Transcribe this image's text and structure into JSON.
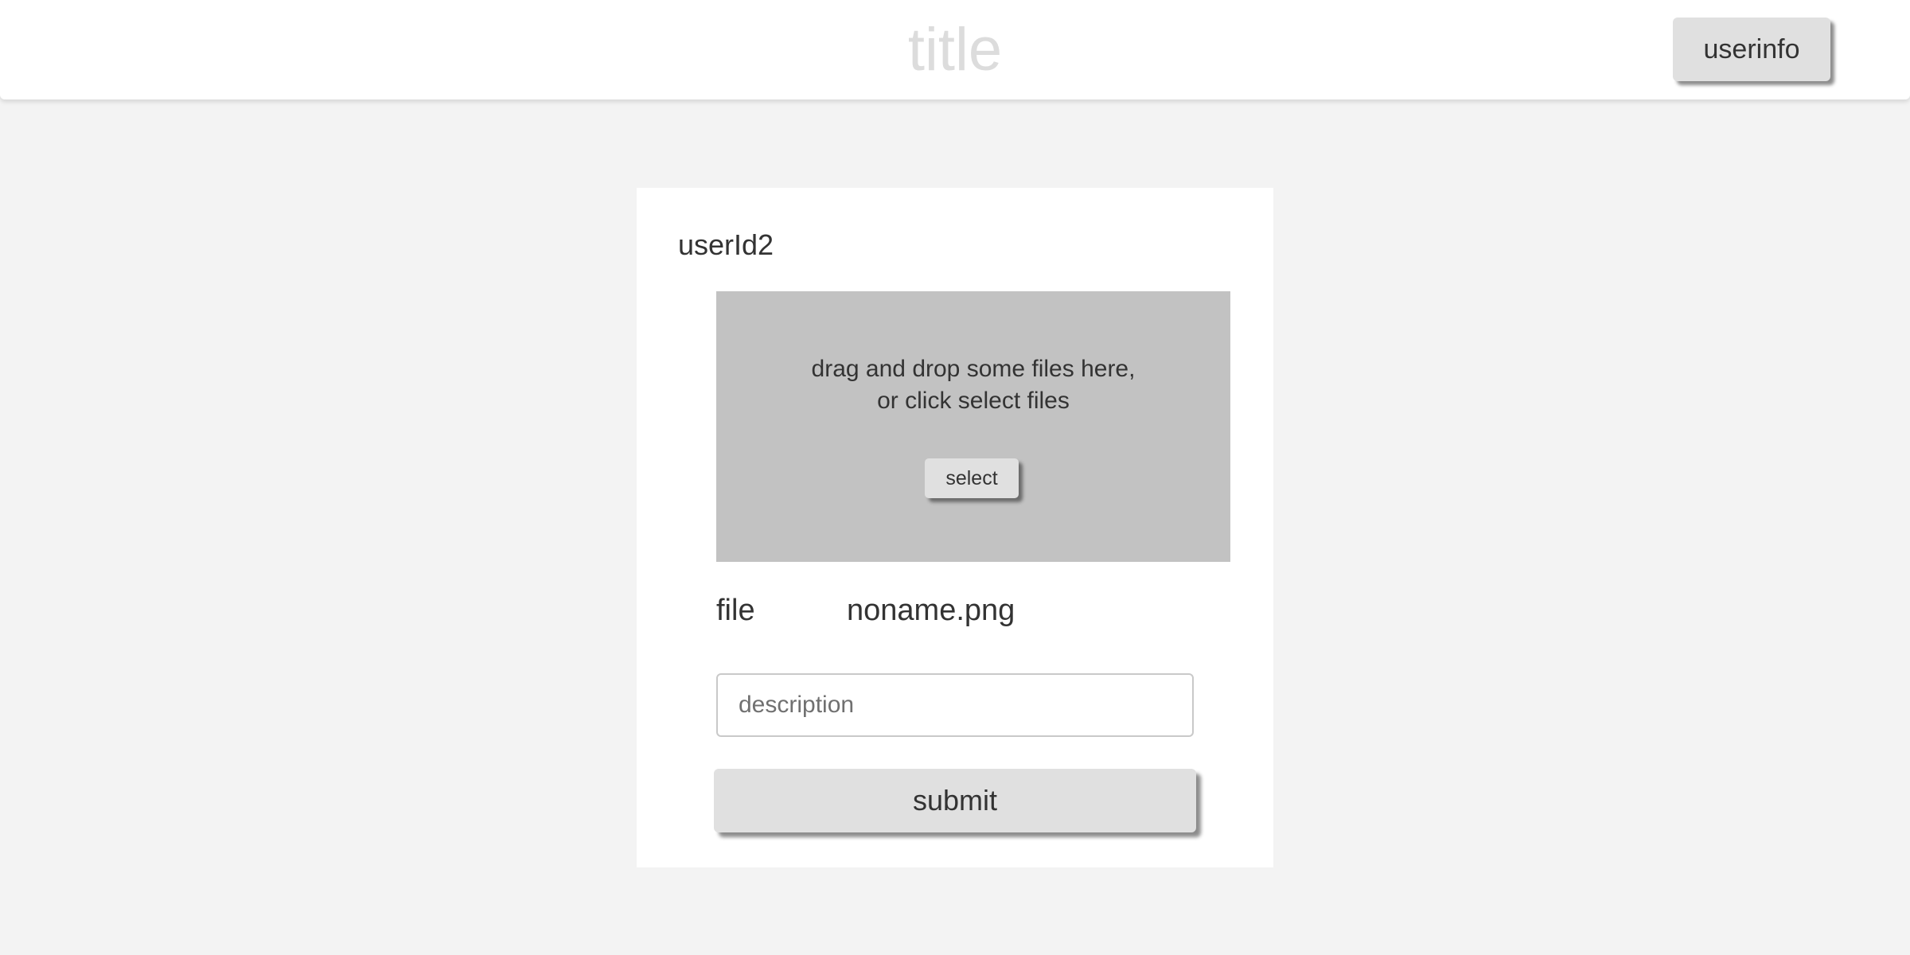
{
  "header": {
    "title": "title",
    "userinfo_label": "userinfo"
  },
  "card": {
    "user_id": "userId2",
    "dropzone": {
      "line1": "drag and drop some files here,",
      "line2": "or click select files",
      "select_label": "select",
      "background": "#c2c2c2"
    },
    "file": {
      "label": "file",
      "name": "noname.png"
    },
    "description": {
      "value": "",
      "placeholder": "description"
    },
    "submit_label": "submit"
  },
  "colors": {
    "page_background": "#f3f3f3",
    "button_background": "#e0e0e0",
    "title_color": "#dcdcdc"
  }
}
